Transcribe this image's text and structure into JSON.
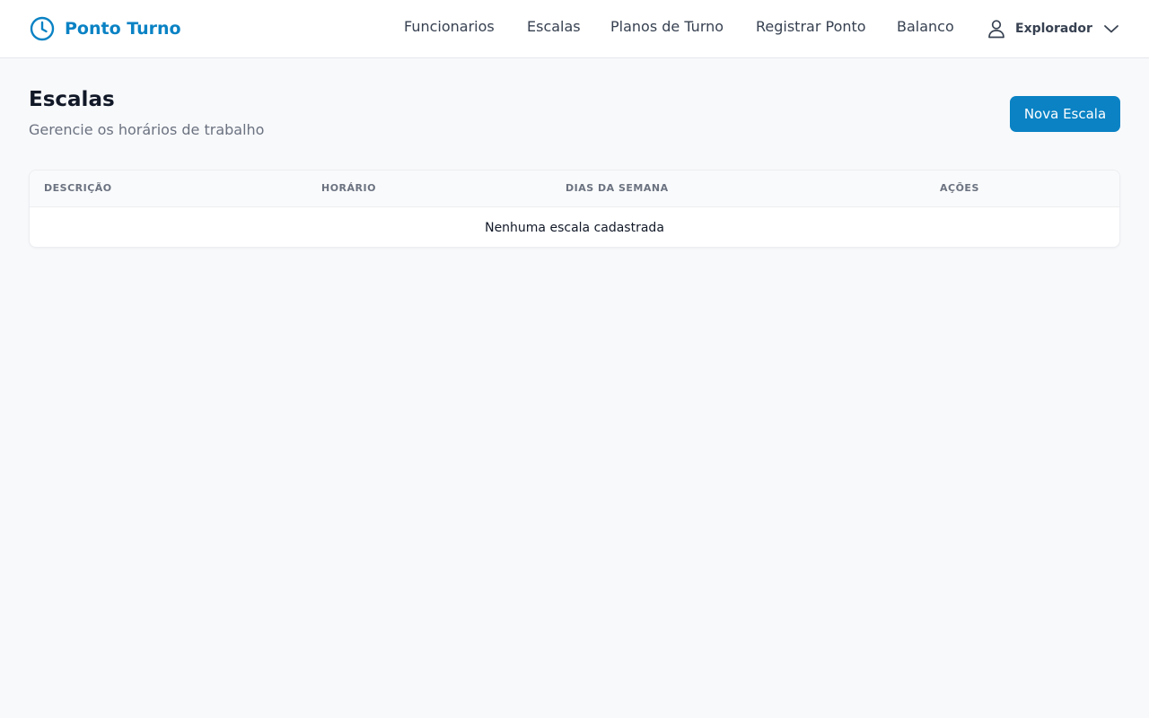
{
  "app": {
    "name": "Ponto Turno",
    "brand_color": "#0a82c4"
  },
  "nav": {
    "items": [
      {
        "label": "Funcionarios"
      },
      {
        "label": "Escalas"
      },
      {
        "label": "Planos de Turno"
      },
      {
        "label": "Registrar Ponto"
      },
      {
        "label": "Balanco"
      }
    ]
  },
  "user": {
    "name": "Explorador",
    "icon": "user-icon",
    "menu_icon": "chevron-down-icon"
  },
  "page": {
    "title": "Escalas",
    "subtitle": "Gerencie os horários de trabalho",
    "new_button_label": "Nova Escala"
  },
  "table": {
    "columns": [
      "DESCRIÇÃO",
      "HORÁRIO",
      "DIAS DA SEMANA",
      "AÇÕES"
    ],
    "empty_message": "Nenhuma escala cadastrada"
  }
}
